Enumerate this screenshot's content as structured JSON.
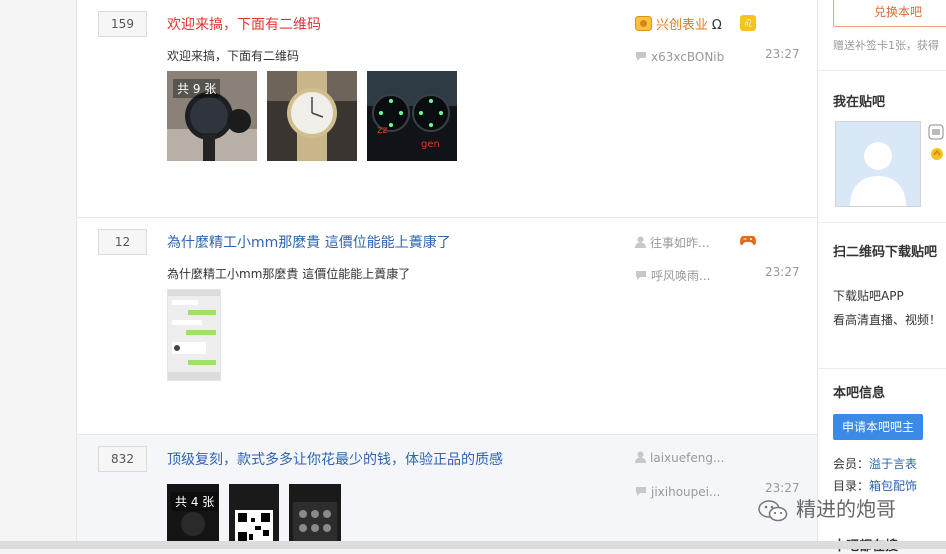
{
  "threads": [
    {
      "reply_count": "159",
      "title": "欢迎来搞，下面有二维码",
      "abstract": "欢迎来搞，下面有二维码",
      "author": "兴创表业",
      "last_replier": "x63xcBONib",
      "time": "23:27",
      "pic_count": "共 9 张",
      "pic_overlay_1": "zz",
      "pic_overlay_2": "gen"
    },
    {
      "reply_count": "12",
      "title": "為什麼精工小mm那麼貴 這價位能能上蕢康了",
      "abstract": "為什麼精工小mm那麼貴 這價位能能上蕢康了",
      "author": "往事如昨...",
      "last_replier": "呼风唤雨...",
      "time": "23:27"
    },
    {
      "reply_count": "832",
      "title": "顶级复刻，款式多多让你花最少的钱，体验正品的质感",
      "abstract": "",
      "author": "laixuefeng...",
      "last_replier": "jixihoupei...",
      "time": "23:27",
      "pic_count": "共 4 张"
    }
  ],
  "sidebar": {
    "exchange_button": "兑换本吧",
    "exchange_note": "赠送补签卡1张，获得",
    "my_in_bar_title": "我在贴吧",
    "qr_title": "扫二维码下载贴吧",
    "download_app": "下载贴吧APP",
    "download_desc": "看高清直播、视频！",
    "bar_info_title": "本吧信息",
    "apply_button": "申请本吧吧主",
    "members_label": "会员：",
    "members_value": "溢于言表",
    "directory_label": "目录：",
    "directory_value": "箱包配饰",
    "next_section_title": "本吧都在搜"
  },
  "watermark": {
    "text": "精进的炮哥",
    "icon": "wechat-icon"
  },
  "colors": {
    "link_blue": "#2d64b3",
    "title_red": "#e53333",
    "author_orange": "#e07b1c",
    "button_blue": "#3b8ae6"
  }
}
